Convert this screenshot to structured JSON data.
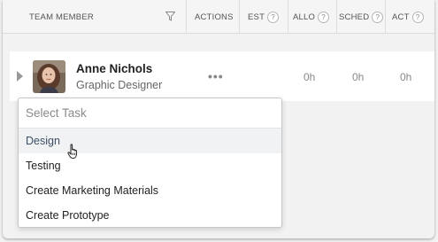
{
  "header": {
    "team_member": "TEAM MEMBER",
    "actions": "ACTIONS",
    "est": "EST",
    "allo": "ALLO",
    "sched": "SCHED",
    "act": "ACT",
    "help_glyph": "?"
  },
  "row": {
    "name": "Anne Nichols",
    "role": "Graphic Designer",
    "actions_glyph": "•••",
    "allo": "0h",
    "sched": "0h",
    "act": "0h"
  },
  "task_dropdown": {
    "placeholder": "Select Task",
    "options": [
      {
        "label": "Design",
        "highlighted": true
      },
      {
        "label": "Testing",
        "highlighted": false
      },
      {
        "label": "Create Marketing Materials",
        "highlighted": false
      },
      {
        "label": "Create Prototype",
        "highlighted": false
      }
    ]
  },
  "icons": [
    "filter-icon",
    "help-icon",
    "expand-caret-icon",
    "more-actions-icon",
    "hand-pointer-cursor-icon"
  ],
  "colors": {
    "highlight_bg": "#f0f2f4",
    "highlight_text": "#3d4f66",
    "header_bg": "#f5f5f5"
  }
}
